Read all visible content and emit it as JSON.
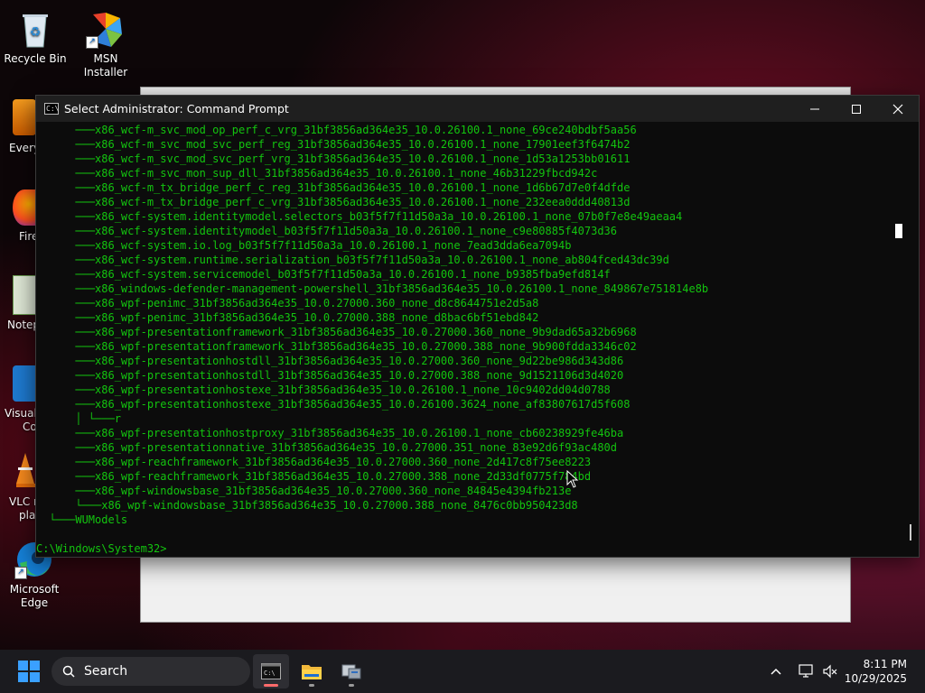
{
  "desktop": {
    "icons": [
      {
        "label": "Recycle Bin"
      },
      {
        "label": "MSN Installer"
      }
    ],
    "partial_icons": [
      "Every",
      "Fire",
      "Notep",
      "Visual",
      "Co",
      "VLC m",
      "pla",
      "Microsoft",
      "Edge"
    ]
  },
  "window": {
    "title": "Select Administrator: Command Prompt",
    "lines": [
      {
        "prefix": "      ───",
        "text": "x86_wcf-m_svc_mod_op_perf_c_vrg_31bf3856ad364e35_10.0.26100.1_none_69ce240bdbf5aa56"
      },
      {
        "prefix": "      ───",
        "text": "x86_wcf-m_svc_mod_svc_perf_reg_31bf3856ad364e35_10.0.26100.1_none_17901eef3f6474b2"
      },
      {
        "prefix": "      ───",
        "text": "x86_wcf-m_svc_mod_svc_perf_vrg_31bf3856ad364e35_10.0.26100.1_none_1d53a1253bb01611"
      },
      {
        "prefix": "      ───",
        "text": "x86_wcf-m_svc_mon_sup_dll_31bf3856ad364e35_10.0.26100.1_none_46b31229fbcd942c"
      },
      {
        "prefix": "      ───",
        "text": "x86_wcf-m_tx_bridge_perf_c_reg_31bf3856ad364e35_10.0.26100.1_none_1d6b67d7e0f4dfde"
      },
      {
        "prefix": "      ───",
        "text": "x86_wcf-m_tx_bridge_perf_c_vrg_31bf3856ad364e35_10.0.26100.1_none_232eea0ddd40813d"
      },
      {
        "prefix": "      ───",
        "text": "x86_wcf-system.identitymodel.selectors_b03f5f7f11d50a3a_10.0.26100.1_none_07b0f7e8e49aeaa4"
      },
      {
        "prefix": "      ───",
        "text": "x86_wcf-system.identitymodel_b03f5f7f11d50a3a_10.0.26100.1_none_c9e80885f4073d36"
      },
      {
        "prefix": "      ───",
        "text": "x86_wcf-system.io.log_b03f5f7f11d50a3a_10.0.26100.1_none_7ead3dda6ea7094b"
      },
      {
        "prefix": "      ───",
        "text": "x86_wcf-system.runtime.serialization_b03f5f7f11d50a3a_10.0.26100.1_none_ab804fced43dc39d"
      },
      {
        "prefix": "      ───",
        "text": "x86_wcf-system.servicemodel_b03f5f7f11d50a3a_10.0.26100.1_none_b9385fba9efd814f"
      },
      {
        "prefix": "      ───",
        "text": "x86_windows-defender-management-powershell_31bf3856ad364e35_10.0.26100.1_none_849867e751814e8b"
      },
      {
        "prefix": "      ───",
        "text": "x86_wpf-penimc_31bf3856ad364e35_10.0.27000.360_none_d8c8644751e2d5a8"
      },
      {
        "prefix": "      ───",
        "text": "x86_wpf-penimc_31bf3856ad364e35_10.0.27000.388_none_d8bac6bf51ebd842"
      },
      {
        "prefix": "      ───",
        "text": "x86_wpf-presentationframework_31bf3856ad364e35_10.0.27000.360_none_9b9dad65a32b6968"
      },
      {
        "prefix": "      ───",
        "text": "x86_wpf-presentationframework_31bf3856ad364e35_10.0.27000.388_none_9b900fdda3346c02"
      },
      {
        "prefix": "      ───",
        "text": "x86_wpf-presentationhostdll_31bf3856ad364e35_10.0.27000.360_none_9d22be986d343d86"
      },
      {
        "prefix": "      ───",
        "text": "x86_wpf-presentationhostdll_31bf3856ad364e35_10.0.27000.388_none_9d1521106d3d4020"
      },
      {
        "prefix": "      ───",
        "text": "x86_wpf-presentationhostexe_31bf3856ad364e35_10.0.26100.1_none_10c9402dd04d0788"
      },
      {
        "prefix": "      ───",
        "text": "x86_wpf-presentationhostexe_31bf3856ad364e35_10.0.26100.3624_none_af83807617d5f608"
      },
      {
        "prefix": "      │ └───",
        "text": "r"
      },
      {
        "prefix": "      ───",
        "text": "x86_wpf-presentationhostproxy_31bf3856ad364e35_10.0.26100.1_none_cb60238929fe46ba"
      },
      {
        "prefix": "      ───",
        "text": "x86_wpf-presentationnative_31bf3856ad364e35_10.0.27000.351_none_83e92d6f93ac480d"
      },
      {
        "prefix": "      ───",
        "text": "x86_wpf-reachframework_31bf3856ad364e35_10.0.27000.360_none_2d417c8f75ee8223"
      },
      {
        "prefix": "      ───",
        "text": "x86_wpf-reachframework_31bf3856ad364e35_10.0.27000.388_none_2d33df0775f784bd"
      },
      {
        "prefix": "      ───",
        "text": "x86_wpf-windowsbase_31bf3856ad364e35_10.0.27000.360_none_84845e4394fb213e"
      },
      {
        "prefix": "      └───",
        "text": "x86_wpf-windowsbase_31bf3856ad364e35_10.0.27000.388_none_8476c0bb950423d8"
      },
      {
        "prefix": "  └───",
        "text": "WUModels"
      },
      {
        "prefix": "",
        "text": ""
      }
    ],
    "prompt": "C:\\Windows\\System32>"
  },
  "taskbar": {
    "search_placeholder": "Search",
    "time": "8:11 PM",
    "date": "10/29/2025"
  }
}
